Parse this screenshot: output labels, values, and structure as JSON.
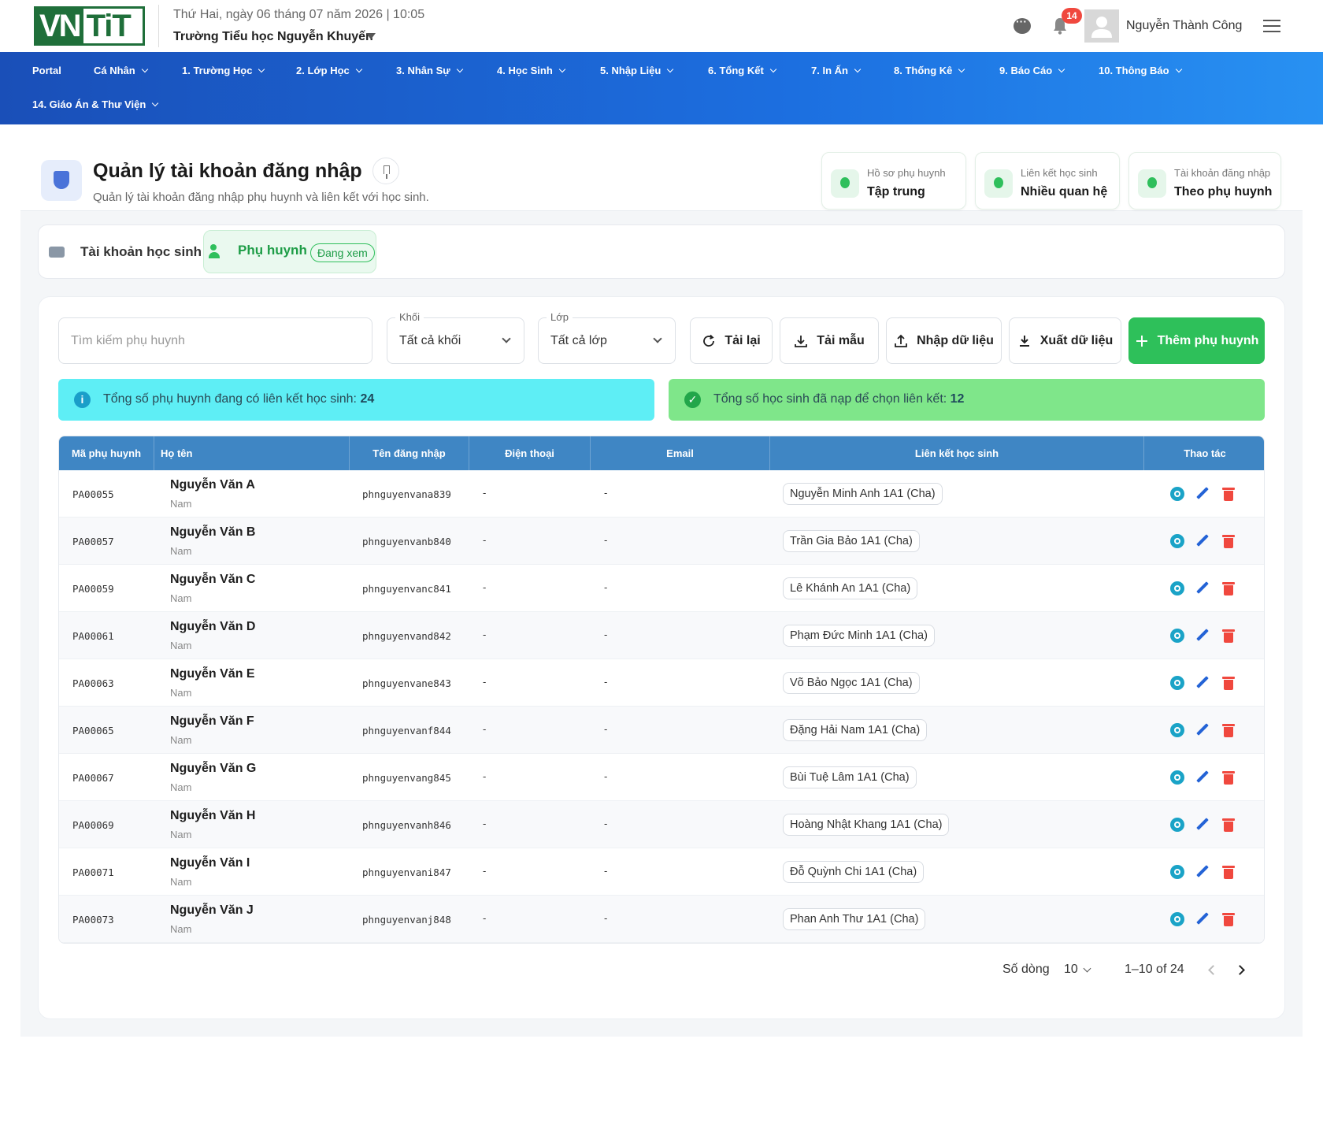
{
  "header": {
    "logo_left": "VN",
    "logo_right": "TiT",
    "date": "Thứ Hai, ngày 06 tháng 07 năm 2026 | 10:05",
    "school": "Trường Tiểu học Nguyễn Khuyến",
    "notification_count": "14",
    "user_name": "Nguyễn Thành Công"
  },
  "nav": {
    "items": [
      {
        "label": "Portal",
        "dropdown": false
      },
      {
        "label": "Cá Nhân",
        "dropdown": true
      },
      {
        "label": "1. Trường Học",
        "dropdown": true
      },
      {
        "label": "2. Lớp Học",
        "dropdown": true
      },
      {
        "label": "3. Nhân Sự",
        "dropdown": true
      },
      {
        "label": "4. Học Sinh",
        "dropdown": true
      },
      {
        "label": "5. Nhập Liệu",
        "dropdown": true
      },
      {
        "label": "6. Tổng Kết",
        "dropdown": true
      },
      {
        "label": "7. In Ấn",
        "dropdown": true
      },
      {
        "label": "8. Thống Kê",
        "dropdown": true
      },
      {
        "label": "9. Báo Cáo",
        "dropdown": true
      },
      {
        "label": "10. Thông Báo",
        "dropdown": true
      },
      {
        "label": "14. Giáo Án & Thư Viện",
        "dropdown": true
      }
    ]
  },
  "page": {
    "title": "Quản lý tài khoản đăng nhập",
    "subtitle": "Quản lý tài khoản đăng nhập phụ huynh và liên kết với học sinh.",
    "cards": [
      {
        "label": "Hồ sơ phụ huynh",
        "value": "Tập trung"
      },
      {
        "label": "Liên kết học sinh",
        "value": "Nhiều quan hệ"
      },
      {
        "label": "Tài khoản đăng nhập",
        "value": "Theo phụ huynh"
      }
    ]
  },
  "tabs": {
    "student": "Tài khoản học sinh",
    "parent": "Phụ huynh",
    "parent_badge": "Đang xem"
  },
  "filters": {
    "search_placeholder": "Tìm kiếm phụ huynh",
    "grade_label": "Khối",
    "grade_value": "Tất cả khối",
    "class_label": "Lớp",
    "class_value": "Tất cả lớp"
  },
  "toolbar": {
    "reload": "Tải lại",
    "template": "Tải mẫu",
    "import": "Nhập dữ liệu",
    "export": "Xuất dữ liệu",
    "add": "Thêm phụ huynh"
  },
  "banners": {
    "info_text": "Tổng số phụ huynh đang có liên kết học sinh: ",
    "info_count": "24",
    "ok_text": "Tổng số học sinh đã nạp để chọn liên kết: ",
    "ok_count": "12"
  },
  "table": {
    "columns": [
      "Mã phụ huynh",
      "Họ tên",
      "Tên đăng nhập",
      "Điện thoại",
      "Email",
      "Liên kết học sinh",
      "Thao tác"
    ],
    "rows": [
      {
        "code": "PA00055",
        "name": "Nguyễn Văn A",
        "gender": "Nam",
        "username": "phnguyenvana839",
        "phone": "-",
        "email": "-",
        "link": "Nguyễn Minh Anh 1A1 (Cha)"
      },
      {
        "code": "PA00057",
        "name": "Nguyễn Văn B",
        "gender": "Nam",
        "username": "phnguyenvanb840",
        "phone": "-",
        "email": "-",
        "link": "Trần Gia Bảo 1A1 (Cha)"
      },
      {
        "code": "PA00059",
        "name": "Nguyễn Văn C",
        "gender": "Nam",
        "username": "phnguyenvanc841",
        "phone": "-",
        "email": "-",
        "link": "Lê Khánh An 1A1 (Cha)"
      },
      {
        "code": "PA00061",
        "name": "Nguyễn Văn D",
        "gender": "Nam",
        "username": "phnguyenvand842",
        "phone": "-",
        "email": "-",
        "link": "Phạm Đức Minh 1A1 (Cha)"
      },
      {
        "code": "PA00063",
        "name": "Nguyễn Văn E",
        "gender": "Nam",
        "username": "phnguyenvane843",
        "phone": "-",
        "email": "-",
        "link": "Võ Bảo Ngọc 1A1 (Cha)"
      },
      {
        "code": "PA00065",
        "name": "Nguyễn Văn F",
        "gender": "Nam",
        "username": "phnguyenvanf844",
        "phone": "-",
        "email": "-",
        "link": "Đặng Hải Nam 1A1 (Cha)"
      },
      {
        "code": "PA00067",
        "name": "Nguyễn Văn G",
        "gender": "Nam",
        "username": "phnguyenvang845",
        "phone": "-",
        "email": "-",
        "link": "Bùi Tuệ Lâm 1A1 (Cha)"
      },
      {
        "code": "PA00069",
        "name": "Nguyễn Văn H",
        "gender": "Nam",
        "username": "phnguyenvanh846",
        "phone": "-",
        "email": "-",
        "link": "Hoàng Nhật Khang 1A1 (Cha)"
      },
      {
        "code": "PA00071",
        "name": "Nguyễn Văn I",
        "gender": "Nam",
        "username": "phnguyenvani847",
        "phone": "-",
        "email": "-",
        "link": "Đỗ Quỳnh Chi 1A1 (Cha)"
      },
      {
        "code": "PA00073",
        "name": "Nguyễn Văn J",
        "gender": "Nam",
        "username": "phnguyenvanj848",
        "phone": "-",
        "email": "-",
        "link": "Phan Anh Thư 1A1 (Cha)"
      }
    ]
  },
  "pagination": {
    "rows_label": "Số dòng",
    "rows_value": "10",
    "range": "1–10 of 24"
  },
  "colors": {
    "nav_start": "#1a4fb8",
    "nav_end": "#2891f2",
    "primary_green": "#2ec05a",
    "table_header": "#3f86c4",
    "info_banner": "#5eeef5",
    "ok_banner": "#7fe68a",
    "danger": "#f0483e"
  }
}
